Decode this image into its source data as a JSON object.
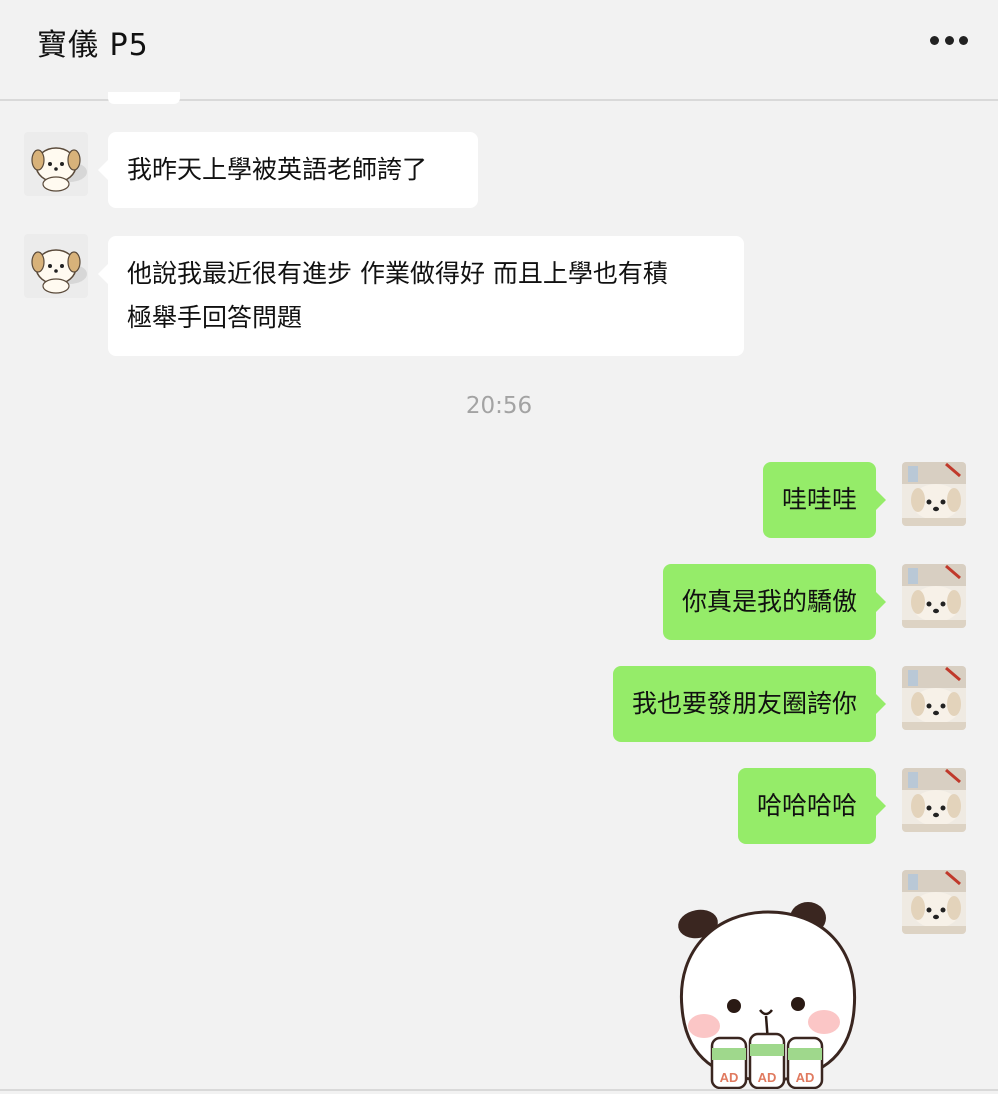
{
  "header": {
    "title": "寶儀 P5",
    "more_icon": "more-dots-icon"
  },
  "colors": {
    "background": "#f2f2f2",
    "incoming_bubble": "#ffffff",
    "outgoing_bubble": "#95ec69",
    "timestamp": "#a3a3a3"
  },
  "messages": {
    "incoming": [
      {
        "text": "我昨天上學被英語老師誇了",
        "avatar": "cartoon-puppy-avatar"
      },
      {
        "line1": "他說我最近很有進步 作業做得好 而且上學也有積",
        "line2": "極舉手回答問題",
        "avatar": "cartoon-puppy-avatar"
      }
    ],
    "timestamp": "20:56",
    "outgoing": [
      {
        "text": "哇哇哇",
        "avatar": "dog-photo-avatar"
      },
      {
        "text": "你真是我的驕傲",
        "avatar": "dog-photo-avatar"
      },
      {
        "text": "我也要發朋友圈誇你",
        "avatar": "dog-photo-avatar"
      },
      {
        "text": "哈哈哈哈",
        "avatar": "dog-photo-avatar"
      }
    ],
    "sticker": {
      "description_icon": "panda-bear-sticker",
      "bottle_label": "AD"
    }
  }
}
